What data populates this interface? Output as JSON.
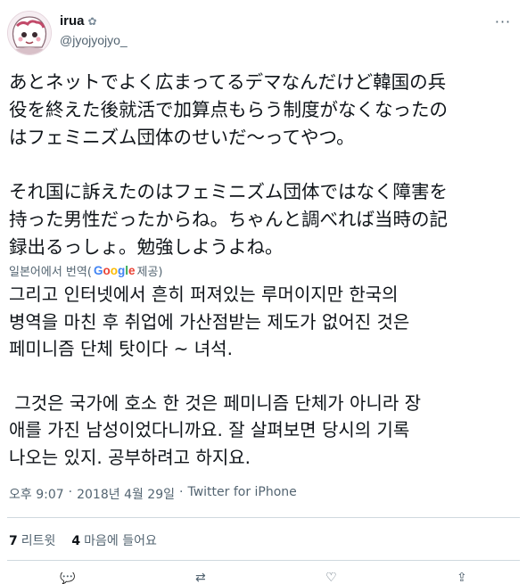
{
  "user": {
    "display_name": "irua",
    "handle": "@jyojyojyo_"
  },
  "tweet": {
    "original_lines": [
      "あとネットでよく広まってるデマなんだけど韓国の兵",
      "役を終えた後就活で加算点もらう制度がなくなったの",
      "はフェミニズム団体のせいだ〜ってやつ。",
      "",
      "それ国に訴えたのはフェミニズム団体ではなく障害を",
      "持った男性だったからね。ちゃんと調べれば当時の記",
      "録出るっしょ。勉強しようよね。"
    ],
    "translate_label_prefix": "일본어에서 번역(",
    "translate_label_suffix": " 제공)",
    "translated_lines": [
      "그리고 인터넷에서 흔히 퍼져있는 루머이지만 한국의",
      "병역을 마친 후 취업에 가산점받는 제도가 없어진 것은",
      "페미니즘 단체 탓이다 ~ 녀석.",
      "",
      " 그것은 국가에 호소 한 것은 페미니즘 단체가 아니라 장",
      "애를 가진 남성이었다니까요. 잘 살펴보면 당시의 기록",
      "나오는 있지. 공부하려고 하지요."
    ],
    "time": "오후 9:07",
    "date": "2018년 4월 29일",
    "source": "Twitter for iPhone"
  },
  "stats": {
    "retweets_count": "7",
    "retweets_label": "리트윗",
    "likes_count": "4",
    "likes_label": "마음에 들어요"
  },
  "icons": {
    "more": "more-icon",
    "reply": "reply-icon",
    "retweet": "retweet-icon",
    "like": "like-icon",
    "share": "share-icon"
  },
  "colors": {
    "text": "#0f1419",
    "secondary": "#536471",
    "divider": "#cfd9de"
  }
}
